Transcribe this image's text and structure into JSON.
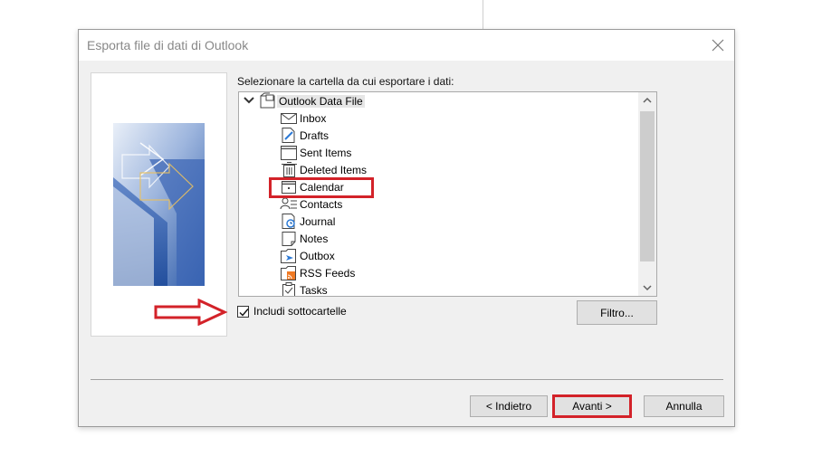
{
  "dialog": {
    "title": "Esporta file di dati di Outlook",
    "prompt": "Selezionare la cartella da cui esportare i dati:",
    "tree": {
      "root": {
        "label": "Outlook Data File",
        "icon": "data-file-icon",
        "expanded": true
      },
      "items": [
        {
          "label": "Inbox",
          "icon": "inbox-icon"
        },
        {
          "label": "Drafts",
          "icon": "drafts-icon"
        },
        {
          "label": "Sent Items",
          "icon": "sent-items-icon"
        },
        {
          "label": "Deleted Items",
          "icon": "deleted-items-icon"
        },
        {
          "label": "Calendar",
          "icon": "calendar-icon",
          "highlighted": true
        },
        {
          "label": "Contacts",
          "icon": "contacts-icon"
        },
        {
          "label": "Journal",
          "icon": "journal-icon"
        },
        {
          "label": "Notes",
          "icon": "notes-icon"
        },
        {
          "label": "Outbox",
          "icon": "outbox-icon"
        },
        {
          "label": "RSS Feeds",
          "icon": "rss-feeds-icon"
        },
        {
          "label": "Tasks",
          "icon": "tasks-icon"
        }
      ]
    },
    "include_subfolders": {
      "label": "Includi sottocartelle",
      "checked": true
    },
    "buttons": {
      "filter": "Filtro...",
      "back": "< Indietro",
      "next": "Avanti >",
      "cancel": "Annulla"
    }
  },
  "colors": {
    "highlight": "#d32229",
    "dialog_bg": "#f0f0f0"
  }
}
